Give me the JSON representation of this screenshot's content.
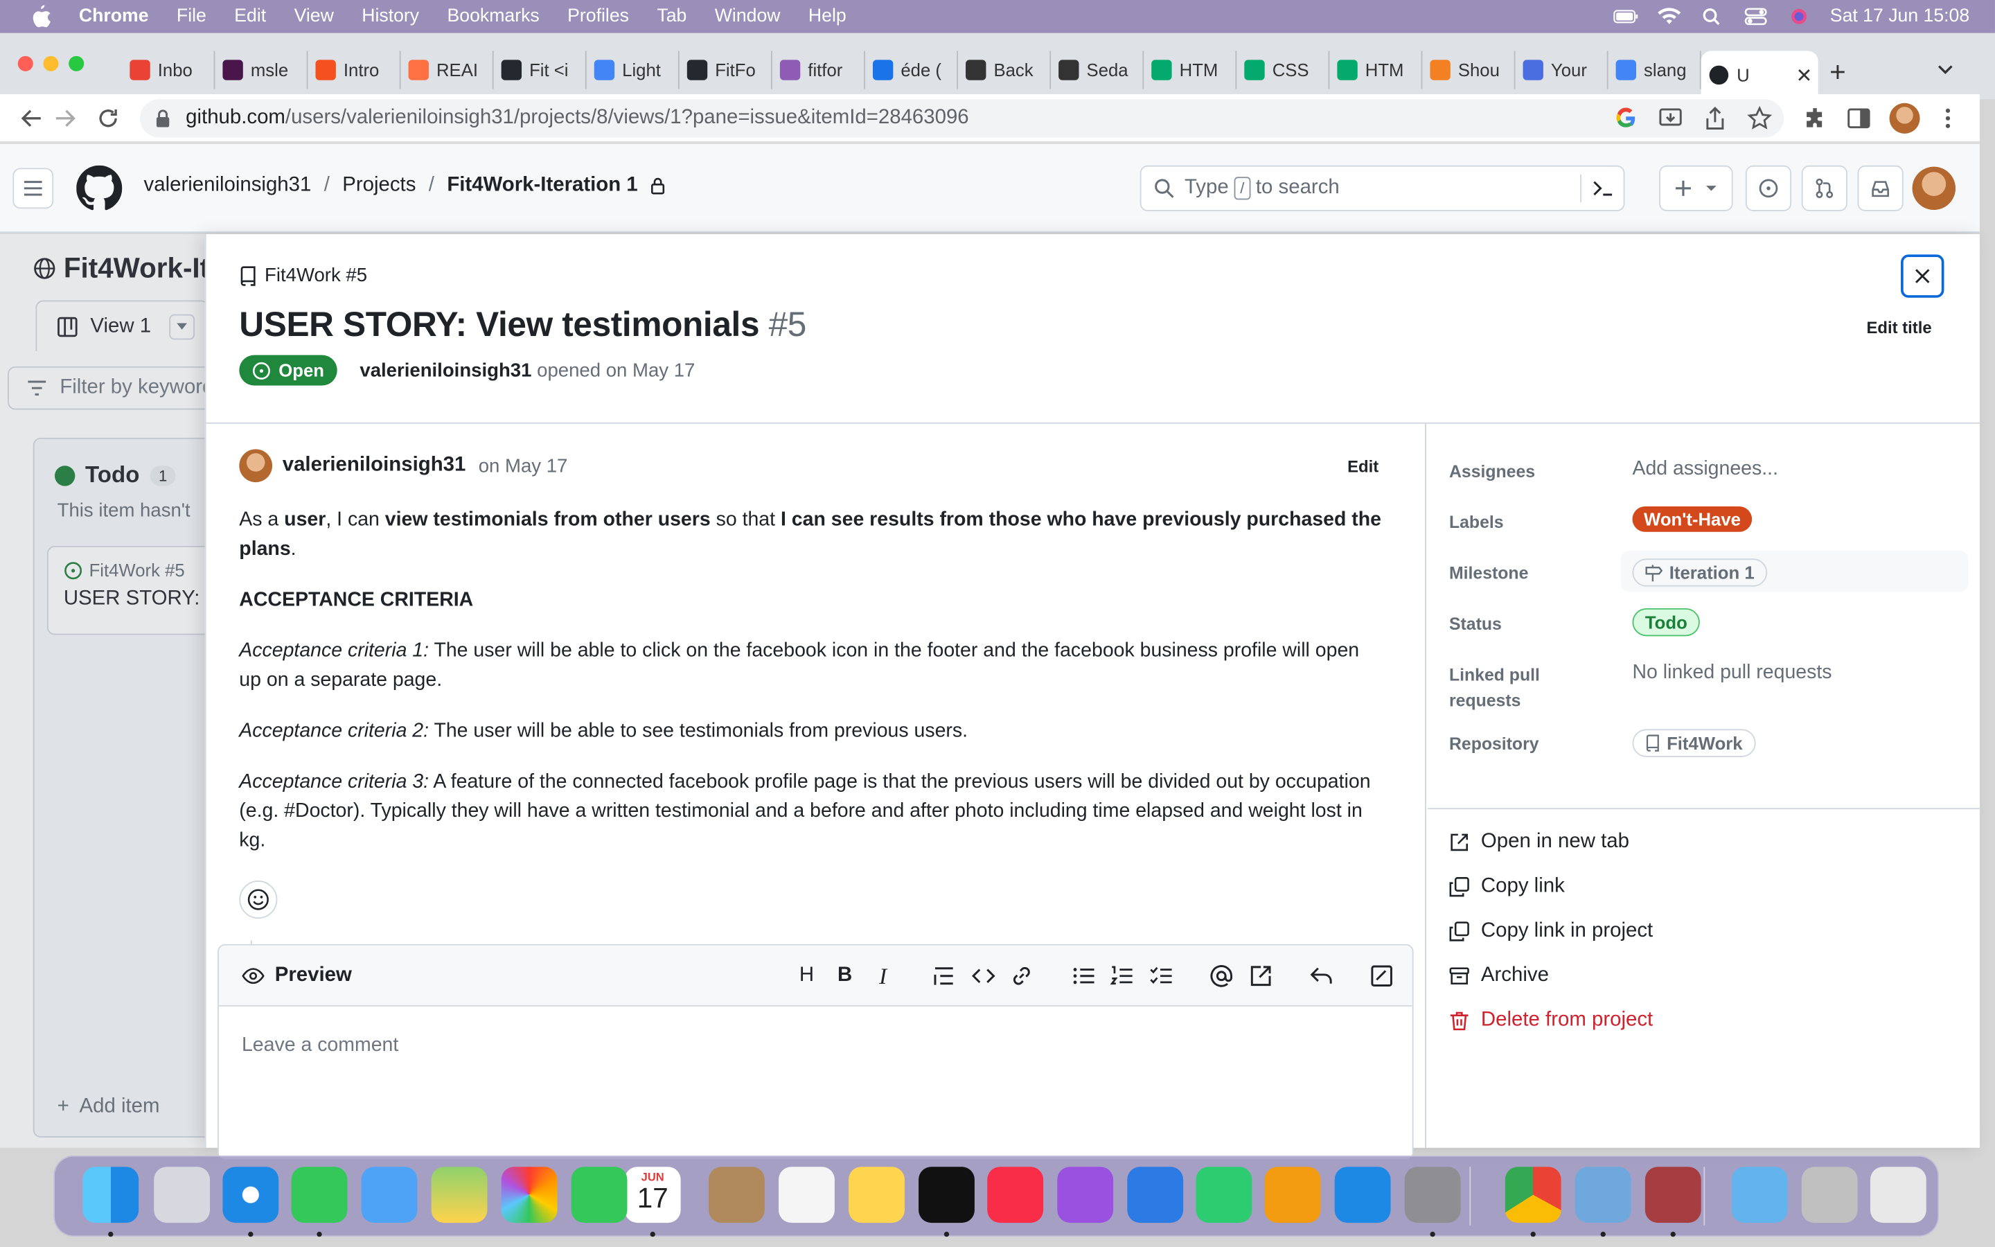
{
  "menubar": {
    "app": "Chrome",
    "items": [
      "File",
      "Edit",
      "View",
      "History",
      "Bookmarks",
      "Profiles",
      "Tab",
      "Window",
      "Help"
    ],
    "datetime": "Sat 17 Jun  15:08"
  },
  "browser": {
    "tabs": [
      {
        "label": "Inbo",
        "color": "#ea4335"
      },
      {
        "label": "msle",
        "color": "#4a154b"
      },
      {
        "label": "Intro",
        "color": "#f4511e"
      },
      {
        "label": "REAI",
        "color": "#ff7043"
      },
      {
        "label": "Fit <i",
        "color": "#24292f"
      },
      {
        "label": "Light",
        "color": "#4285f4"
      },
      {
        "label": "FitFo",
        "color": "#24292f"
      },
      {
        "label": "fitfor",
        "color": "#8e5bb5"
      },
      {
        "label": "éde (",
        "color": "#1a73e8"
      },
      {
        "label": "Back",
        "color": "#333"
      },
      {
        "label": "Seda",
        "color": "#333"
      },
      {
        "label": "HTM",
        "color": "#04aa6d"
      },
      {
        "label": "CSS",
        "color": "#04aa6d"
      },
      {
        "label": "HTM",
        "color": "#04aa6d"
      },
      {
        "label": "Shou",
        "color": "#f48024"
      },
      {
        "label": "Your",
        "color": "#4a6ee0"
      },
      {
        "label": "slang",
        "color": "#4285f4"
      }
    ],
    "active_tab": "U",
    "url_host": "github.com",
    "url_path": "/users/valerieniloinsigh31/projects/8/views/1?pane=issue&itemId=28463096"
  },
  "github": {
    "breadcrumb": [
      "valerieniloinsigh31",
      "Projects",
      "Fit4Work-Iteration 1"
    ],
    "search_placeholder_pre": "Type",
    "search_key": "/",
    "search_placeholder_post": "to search"
  },
  "project": {
    "title": "Fit4Work-It",
    "view_tab": "View 1",
    "filter_placeholder": "Filter by keyword",
    "column": {
      "name": "Todo",
      "count": "1",
      "note": "This item hasn't"
    },
    "card": {
      "repo": "Fit4Work #5",
      "title": "USER STORY: V"
    },
    "add_item": "Add item"
  },
  "issue": {
    "repo_ref": "Fit4Work #5",
    "title": "USER STORY: View testimonials",
    "number": "#5",
    "edit_title": "Edit title",
    "state": "Open",
    "opener": "valerieniloinsigh31",
    "opened_text": "opened on May 17",
    "comment_author": "valerieniloinsigh31",
    "comment_date": "on May 17",
    "edit": "Edit",
    "body": {
      "p1_a": "As a ",
      "p1_b": "user",
      "p1_c": ", I can ",
      "p1_d": "view testimonials from other users",
      "p1_e": " so that ",
      "p1_f": "I can see results from those who have previously purchased the plans",
      "p1_g": ".",
      "heading": "ACCEPTANCE CRITERIA",
      "ac1_label": "Acceptance criteria 1:",
      "ac1_text": " The user will be able to click on the facebook icon in the footer and the facebook business profile will open up on a separate page.",
      "ac2_label": "Acceptance criteria 2:",
      "ac2_text": " The user will be able to see testimonials from previous users.",
      "ac3_label": "Acceptance criteria 3:",
      "ac3_text": " A feature of the connected facebook profile page is that the previous users will be divided out by occupation (e.g. #Doctor). Typically they will have a written testimonial and a before and after photo including time elapsed and weight lost in kg."
    },
    "composer": {
      "preview": "Preview",
      "placeholder": "Leave a comment"
    }
  },
  "fields": {
    "assignees_label": "Assignees",
    "assignees_value": "Add assignees...",
    "labels_label": "Labels",
    "labels_value": "Won't-Have",
    "labels_color": "#d4491b",
    "milestone_label": "Milestone",
    "milestone_value": "Iteration 1",
    "status_label": "Status",
    "status_value": "Todo",
    "linked_label_1": "Linked pull",
    "linked_label_2": "requests",
    "linked_value": "No linked pull requests",
    "repository_label": "Repository",
    "repository_value": "Fit4Work"
  },
  "actions": {
    "open_new_tab": "Open in new tab",
    "copy_link": "Copy link",
    "copy_link_project": "Copy link in project",
    "archive": "Archive",
    "delete": "Delete from project"
  },
  "dock": {
    "calendar_month": "JUN",
    "calendar_day": "17"
  }
}
